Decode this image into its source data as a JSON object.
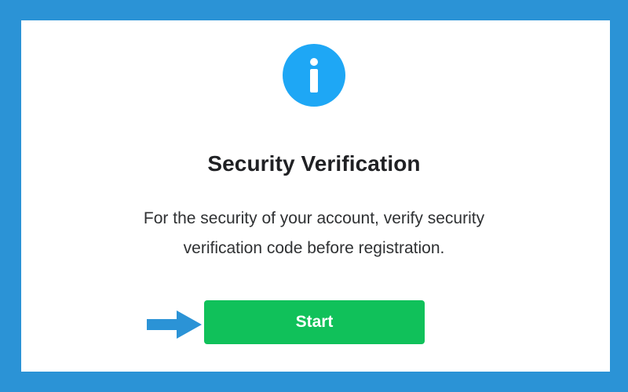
{
  "dialog": {
    "title": "Security Verification",
    "message": "For the security of your account, verify security verification code before registration.",
    "start_label": "Start"
  },
  "icons": {
    "info": "info-icon",
    "pointer": "arrow-right-icon"
  },
  "colors": {
    "outer_border": "#2b93d6",
    "panel": "#ffffff",
    "info_badge": "#1ea7f5",
    "button": "#10c15a",
    "arrow": "#2b93d6",
    "title_text": "#202124",
    "body_text": "#2f3133"
  }
}
